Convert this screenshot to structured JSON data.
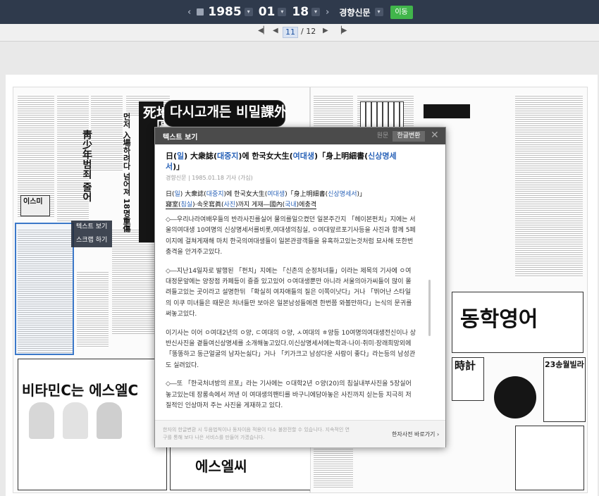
{
  "nav": {
    "year": "1985",
    "month": "01",
    "day": "18",
    "newspaper": "경향신문",
    "go_button": "이동"
  },
  "pager": {
    "current": "11",
    "total": "/ 12"
  },
  "newspaper_page": {
    "headline_top": "다시고개든 비밀課外",
    "headline_vertical_1": "地區黨대회장서5명壓死",
    "headline_vertical_2": "먼저 入場하려다 넘어져 18명重傷",
    "headline_vertical_3": "靑少年범죄 줄어",
    "ad_1": "비타민C는 에스엘C",
    "ad_2": "에스엘씨",
    "ad_3": "동학영어",
    "ad_4": "時計",
    "ad_5": "23송월빌라",
    "ad_6": "이스미"
  },
  "context_menu": {
    "items": [
      "텍스트 보기",
      "스크랩 하기"
    ]
  },
  "modal": {
    "title": "텍스트 보기",
    "tab_original": "원문",
    "tab_hangul": "한글변환",
    "headline_parts": [
      "日(",
      "일",
      ") 大衆誌(",
      "대중지",
      ")에 한국女大生(",
      "여대생",
      ")「身上明細書(",
      "신상명세서",
      ")」"
    ],
    "meta": "경향신문 | 1985.01.18 기사 (가십)",
    "sub_line1": [
      "日(",
      "일",
      ") 大衆誌(",
      "대중지",
      ")에 한국女大生(",
      "여대생",
      ")「身上明細書(",
      "신상명세서",
      ")」"
    ],
    "sub_line2": [
      "寢室(",
      "침실",
      ")·속옷寫眞(",
      "사진",
      ")까지 게재―國內(",
      "국내",
      ")에충격"
    ],
    "paragraphs": [
      "◇―우리나라여배우들의 반라사진를실어 물의를일으켰던 일본주간지 「헤이본펀치」지에는 서울의여대생 10여명의 신상명세서를비롯,여대생의침실, ㅇ여대앞르포기사등을 사진과 함께 5페이지에 걸쳐게재해 마치 한국의여대생들이 일본관광객들을 유혹하고있는것처럼 묘사해 또한번충격을 안겨주고있다.",
      "◇―지난14일자로 발행된 「펀치」지에는 「신촌의 순정처녀들」이라는 제목의 기사에 ㅇ여대정문앞에는 양장점 카페등이 즐즐 있고있어 ㅇ여대생뿐만 아니라 서울의아가씨들이 많이 몰려들고있는 곳이라고 설명한뒤 「확실히 여자애들의 질은 이쪽이낫다」거나 「뛰어난 스타일의 이쿠 미녀들은 때문은 처녀들만 보아온 일본남성들에겐 한번쯤 와볼만하다」는식의 문귀를 써놓고있다.",
      "이기사는 이어 ㅇ여대2년의 ㅇ양, ㄷ여대의 ㅇ양, ㅅ여대의 ㅎ양등 10여명의여대생전신이나 상반신사진을 곁들여신상명세를 소개해놓고있다.이신상명세서에는학과·나이·취미·장래희망외에 「똥똥하고 동근얼굴의 남자는싫다」거나 「키가크고 남성다운 사람이 좋다」라는등의 남성관도 실려있다.",
      "◇―또 「한국처녀방의 르포」라는 기사에는 ㅇ대학2년 ㅇ양(20)의 침실내부사진을 5장실어놓고있는데 장롱속에서 꺼낸 이 여대생의팬티를 바구니에담아놓은 사진까지 싣는등 지극히 저질적인 인상마저 주는 사진을 게재하고 있다."
    ],
    "footer_notice": "한자의 한글변환 시 두음법칙이나 동자이음 적용이 다소 불완전할 수 있습니다. 지속적인 연구를 통해 보다 나은 서비스를 만들어 가겠습니다.",
    "dict_link": "한자사전 바로가기 ›"
  }
}
